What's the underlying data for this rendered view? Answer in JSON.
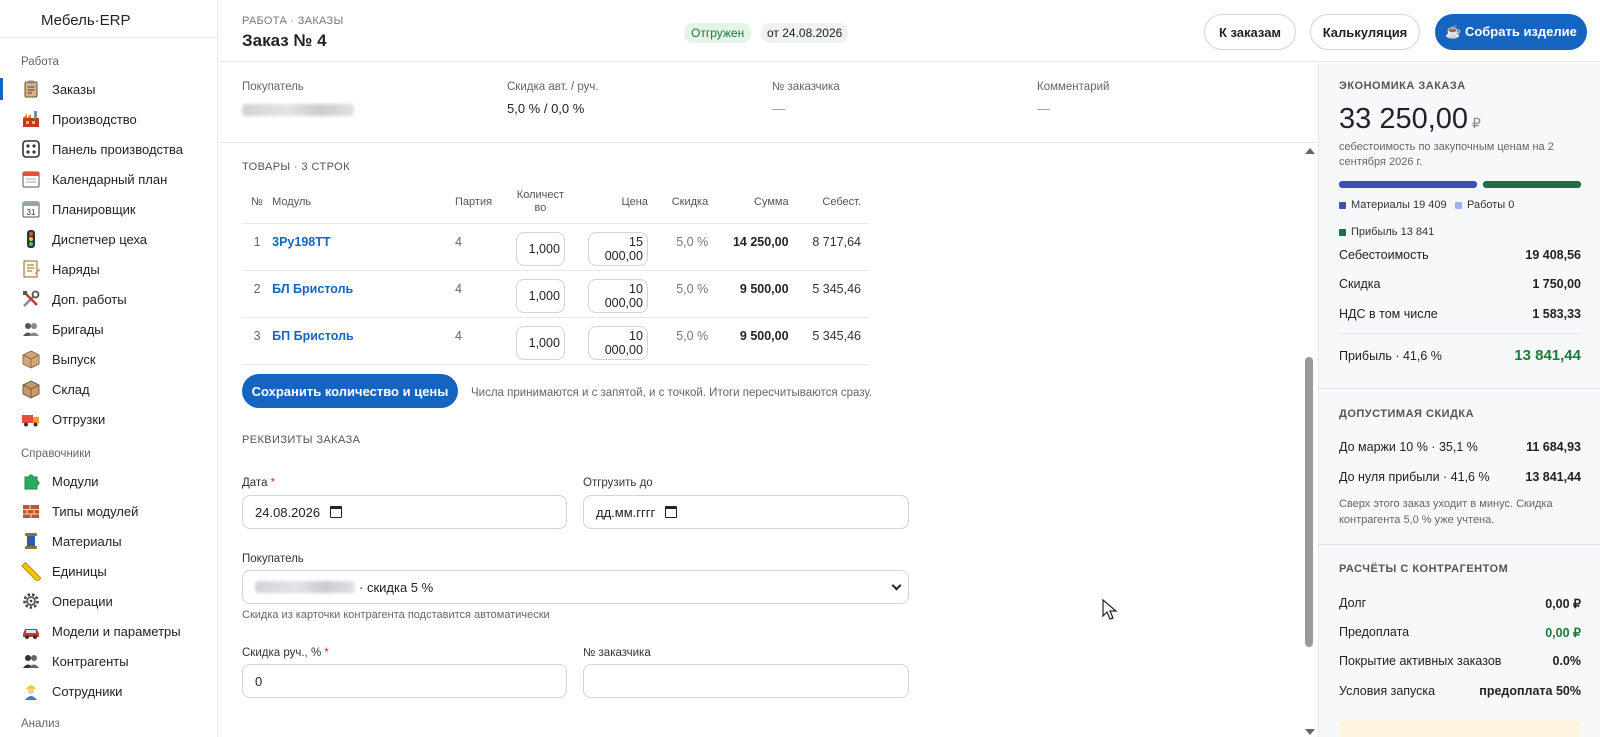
{
  "app": {
    "title": "Мебель·ERP"
  },
  "sidebar": {
    "sections": [
      {
        "title": "Работа"
      },
      {
        "title": "Справочники"
      },
      {
        "title": "Анализ"
      }
    ],
    "work_items": [
      {
        "label": "Заказы",
        "icon": "clipboard-icon",
        "active": true
      },
      {
        "label": "Производство",
        "icon": "factory-icon"
      },
      {
        "label": "Панель производства",
        "icon": "dashboard-dots-icon"
      },
      {
        "label": "Календарный план",
        "icon": "calendar-icon"
      },
      {
        "label": "Планировщик",
        "icon": "calendar-31-icon"
      },
      {
        "label": "Диспетчер цеха",
        "icon": "traffic-light-icon"
      },
      {
        "label": "Наряды",
        "icon": "memo-icon"
      },
      {
        "label": "Доп. работы",
        "icon": "tools-icon"
      },
      {
        "label": "Бригады",
        "icon": "team-icon"
      },
      {
        "label": "Выпуск",
        "icon": "box-icon"
      },
      {
        "label": "Склад",
        "icon": "warehouse-box-icon"
      },
      {
        "label": "Отгрузки",
        "icon": "truck-icon"
      }
    ],
    "ref_items": [
      {
        "label": "Модули",
        "icon": "puzzle-icon"
      },
      {
        "label": "Типы модулей",
        "icon": "bricks-icon"
      },
      {
        "label": "Материалы",
        "icon": "spool-icon"
      },
      {
        "label": "Единицы",
        "icon": "ruler-icon"
      },
      {
        "label": "Операции",
        "icon": "gear-icon"
      },
      {
        "label": "Модели и параметры",
        "icon": "car-icon"
      },
      {
        "label": "Контрагенты",
        "icon": "people-icon"
      },
      {
        "label": "Сотрудники",
        "icon": "worker-icon"
      }
    ]
  },
  "header": {
    "breadcrumb": "РАБОТА · ЗАКАЗЫ",
    "title": "Заказ № 4",
    "status": "Отгружен",
    "date": "от 24.08.2026",
    "buttons": {
      "orders": "К заказам",
      "calc": "Калькуляция",
      "assemble": "☕ Собрать изделие"
    }
  },
  "info": {
    "buyer_label": "Покупатель",
    "discount_label": "Скидка авт. / руч.",
    "discount_value": "5,0 % / 0,0 %",
    "customer_no_label": "№ заказчика",
    "customer_no_value": "—",
    "comment_label": "Комментарий",
    "comment_value": "—"
  },
  "goods": {
    "heading": "ТОВАРЫ · 3 СТРОК",
    "columns": [
      "№",
      "Модуль",
      "Партия",
      "Количест во",
      "Цена",
      "Скидка",
      "Сумма",
      "Себест."
    ],
    "rows": [
      {
        "n": "1",
        "module": "3Ру198ТТ",
        "batch": "4",
        "qty": "1,000",
        "price": "15 000,00",
        "discount": "5,0 %",
        "sum": "14 250,00",
        "cost": "8 717,64"
      },
      {
        "n": "2",
        "module": "БЛ Бристоль",
        "batch": "4",
        "qty": "1,000",
        "price": "10 000,00",
        "discount": "5,0 %",
        "sum": "9 500,00",
        "cost": "5 345,46"
      },
      {
        "n": "3",
        "module": "БП Бристоль",
        "batch": "4",
        "qty": "1,000",
        "price": "10 000,00",
        "discount": "5,0 %",
        "sum": "9 500,00",
        "cost": "5 345,46"
      }
    ],
    "save_button": "Сохранить количество и цены",
    "save_hint": "Числа принимаются и с запятой, и с точкой. Итоги пересчитываются сразу."
  },
  "form": {
    "heading": "РЕКВИЗИТЫ ЗАКАЗА",
    "date_label": "Дата",
    "date_value": "24.08.2026",
    "ship_label": "Отгрузить до",
    "ship_placeholder": "дд.мм.гггг",
    "buyer_label": "Покупатель",
    "buyer_suffix": "· скидка 5 %",
    "buyer_hint": "Скидка из карточки контрагента подставится автоматически",
    "manual_discount_label": "Скидка руч., %",
    "manual_discount_value": "0",
    "customer_no_label": "№ заказчика",
    "required_mark": "*"
  },
  "economics": {
    "heading": "ЭКОНОМИКА ЗАКАЗА",
    "total": "33 250,00",
    "currency": "₽",
    "total_note": "себестоимость по закупочным ценам на 2 сентября 2026 г.",
    "legend": {
      "materials": "Материалы 19 409",
      "works": "Работы 0",
      "profit": "Прибыль 13 841"
    },
    "colors": {
      "materials": "#3f51b5",
      "works": "#9fb4e8",
      "profit": "#1b6e45"
    },
    "bar_shares": {
      "materials": 0.584,
      "works": 0,
      "profit": 0.416
    },
    "rows": [
      {
        "label": "Себестоимость",
        "value": "19 408,56"
      },
      {
        "label": "Скидка",
        "value": "1 750,00"
      },
      {
        "label": "НДС в том числе",
        "value": "1 583,33"
      }
    ],
    "profit_label": "Прибыль · 41,6 %",
    "profit_value": "13 841,44"
  },
  "allowed_discount": {
    "heading": "ДОПУСТИМАЯ СКИДКА",
    "rows": [
      {
        "label": "До маржи 10 % · 35,1 %",
        "value": "11 684,93"
      },
      {
        "label": "До нуля прибыли · 41,6 %",
        "value": "13 841,44"
      }
    ],
    "note": "Сверх этого заказ уходит в минус. Скидка контрагента 5,0 % уже учтена."
  },
  "settlements": {
    "heading": "РАСЧЁТЫ С КОНТРАГЕНТОМ",
    "rows": [
      {
        "label": "Долг",
        "value": "0,00 ₽"
      },
      {
        "label": "Предоплата",
        "value": "0,00 ₽"
      },
      {
        "label": "Покрытие активных заказов",
        "value": "0.0%"
      },
      {
        "label": "Условия запуска",
        "value": "предоплата 50%"
      }
    ]
  }
}
